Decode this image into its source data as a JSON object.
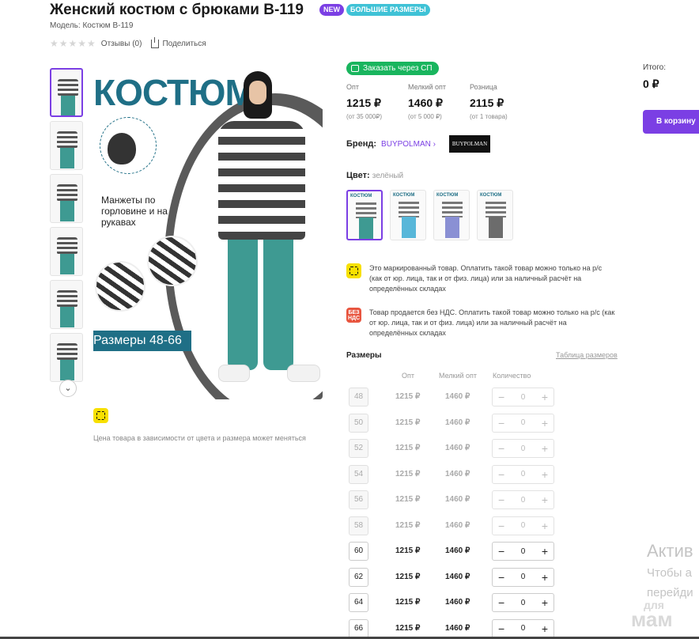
{
  "header": {
    "title": "Женский костюм с брюками B-119",
    "badge_new": "NEW",
    "badge_big": "БОЛЬШИЕ РАЗМЕРЫ",
    "model": "Модель: Костюм B-119",
    "reviews": "Отзывы (0)",
    "share": "Поделиться"
  },
  "gallery": {
    "banner_title": "КОСТЮМ",
    "banner_cuffs": "Манжеты по горловине и на рукавах",
    "banner_sizes": "Размеры 48-66",
    "thumb_count": 6
  },
  "price_note": "Цена товара в зависимости от цвета и размера может меняться",
  "order_button": "Заказать через СП",
  "prices": [
    {
      "label": "Опт",
      "value": "1215 ₽",
      "sub": "(от 35 000₽)"
    },
    {
      "label": "Мелкий опт",
      "value": "1460 ₽",
      "sub": "(от 5 000 ₽)"
    },
    {
      "label": "Розница",
      "value": "2115 ₽",
      "sub": "(от 1 товара)"
    }
  ],
  "total": {
    "label": "Итого:",
    "value": "0 ₽",
    "cart_button": "В корзину"
  },
  "brand": {
    "label": "Бренд:",
    "name": "BUYPOLMAN",
    "logo": "BUYPOLMAN"
  },
  "color": {
    "label": "Цвет:",
    "value": "зелёный",
    "swatches": [
      "#3e9a92",
      "#58b7d9",
      "#8a90d4",
      "#6c6c6c"
    ]
  },
  "notices": {
    "marked": "Это маркированный товар. Оплатить такой товар можно только на р/с (как от юр. лица, так и от физ. лица) или за наличный расчёт на определённых складах",
    "nds_icon": "БЕЗ НДС",
    "nds": "Товар продается без НДС. Оплатить такой товар можно только на р/с (как от юр. лица, так и от физ. лица) или за наличный расчёт на определённых складах"
  },
  "sizes": {
    "title": "Размеры",
    "table_link": "Таблица размеров",
    "headers": [
      "Опт",
      "Мелкий опт",
      "Количество"
    ],
    "rows": [
      {
        "size": "48",
        "opt": "1215 ₽",
        "small": "1460 ₽",
        "qty": "0",
        "available": false
      },
      {
        "size": "50",
        "opt": "1215 ₽",
        "small": "1460 ₽",
        "qty": "0",
        "available": false
      },
      {
        "size": "52",
        "opt": "1215 ₽",
        "small": "1460 ₽",
        "qty": "0",
        "available": false
      },
      {
        "size": "54",
        "opt": "1215 ₽",
        "small": "1460 ₽",
        "qty": "0",
        "available": false
      },
      {
        "size": "56",
        "opt": "1215 ₽",
        "small": "1460 ₽",
        "qty": "0",
        "available": false
      },
      {
        "size": "58",
        "opt": "1215 ₽",
        "small": "1460 ₽",
        "qty": "0",
        "available": false
      },
      {
        "size": "60",
        "opt": "1215 ₽",
        "small": "1460 ₽",
        "qty": "0",
        "available": true
      },
      {
        "size": "62",
        "opt": "1215 ₽",
        "small": "1460 ₽",
        "qty": "0",
        "available": true
      },
      {
        "size": "64",
        "opt": "1215 ₽",
        "small": "1460 ₽",
        "qty": "0",
        "available": true
      },
      {
        "size": "66",
        "opt": "1215 ₽",
        "small": "1460 ₽",
        "qty": "0",
        "available": true
      }
    ]
  },
  "watermark": {
    "line1": "Актив",
    "line2": "Чтобы а",
    "line3": "перейди",
    "logo_small": "для",
    "logo_big": "мам"
  }
}
